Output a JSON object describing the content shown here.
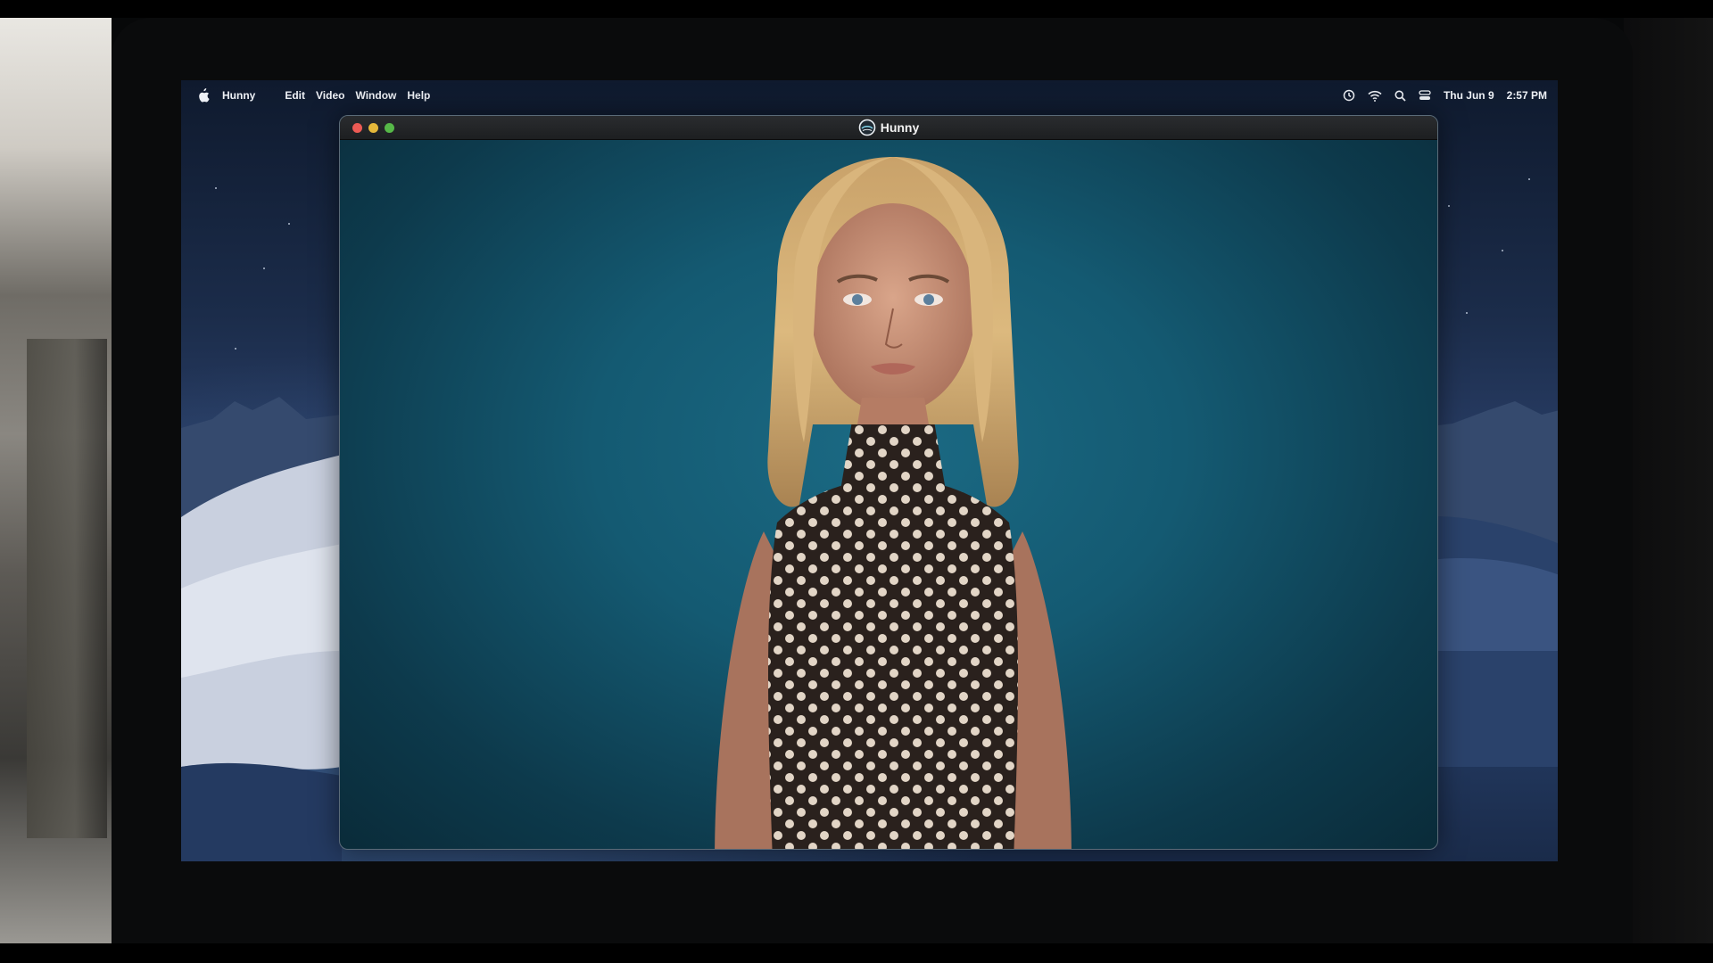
{
  "menubar": {
    "app_name": "Hunny",
    "menus": [
      "Edit",
      "Video",
      "Window",
      "Help"
    ],
    "date": "Thu Jun  9",
    "time": "2:57 PM"
  },
  "status_icons": [
    "time-machine-icon",
    "wifi-icon",
    "spotlight-search-icon",
    "control-center-icon"
  ],
  "window": {
    "title": "Hunny",
    "icon": "hunny-logo-icon",
    "content": "avatar-video-feed"
  },
  "colors": {
    "close": "#ec5a54",
    "minimize": "#e5b83a",
    "maximize": "#56b848",
    "video_background": "#145a72"
  }
}
